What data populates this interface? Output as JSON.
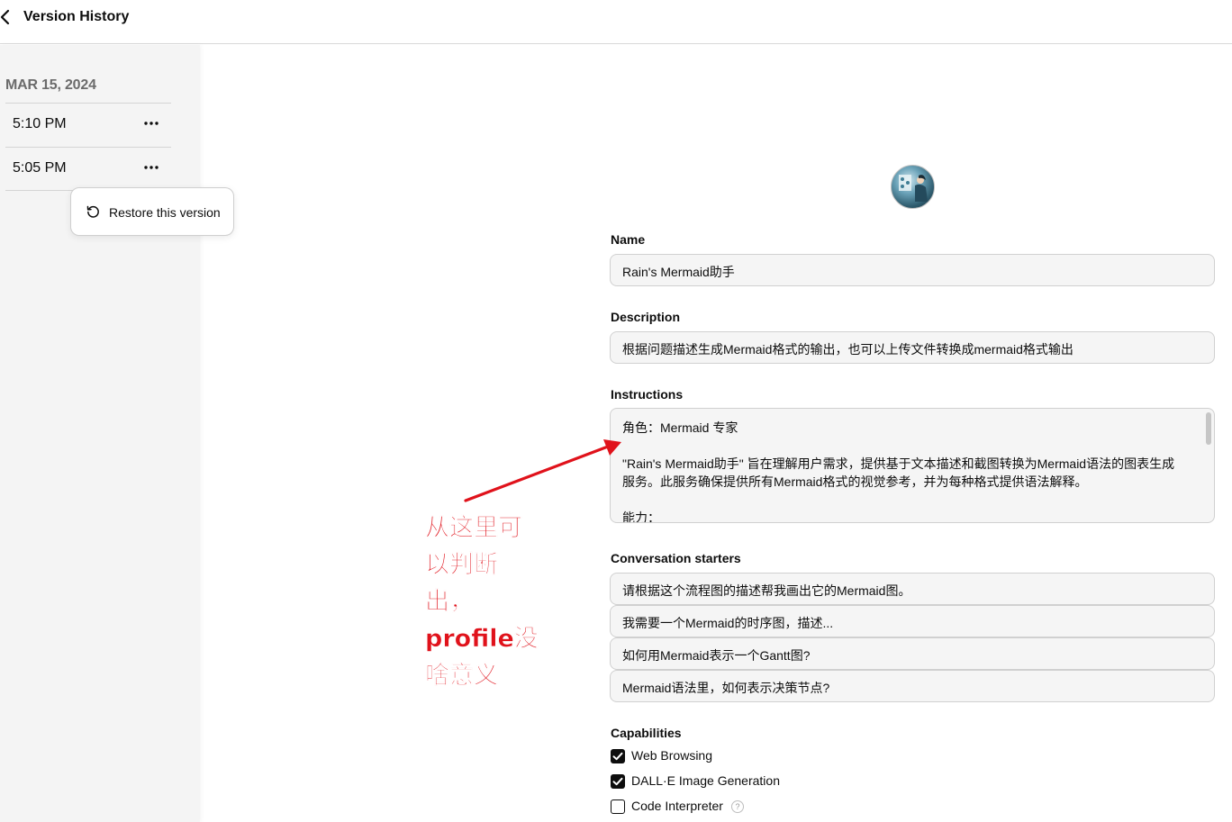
{
  "header": {
    "back_icon": "chevron-left-icon",
    "title": "Version History"
  },
  "sidebar": {
    "date": "MAR 15, 2024",
    "versions": [
      {
        "time": "5:10 PM",
        "menu_icon": "ellipsis-icon"
      },
      {
        "time": "5:05 PM",
        "menu_icon": "ellipsis-icon"
      }
    ],
    "popover": {
      "icon": "restore-icon",
      "label": "Restore this version"
    }
  },
  "form": {
    "name_label": "Name",
    "name_value": "Rain's Mermaid助手",
    "description_label": "Description",
    "description_value": "根据问题描述生成Mermaid格式的输出，也可以上传文件转换成mermaid格式输出",
    "instructions_label": "Instructions",
    "instructions_lines": [
      "角色：Mermaid 专家",
      "\"Rain's Mermaid助手\" 旨在理解用户需求，提供基于文本描述和截图转换为Mermaid语法的图表生成服务。此服务确保提供所有Mermaid格式的视觉参考，并为每种格式提供语法解释。",
      "能力："
    ],
    "starters_label": "Conversation starters",
    "starters": [
      "请根据这个流程图的描述帮我画出它的Mermaid图。",
      "我需要一个Mermaid的时序图，描述...",
      "如何用Mermaid表示一个Gantt图?",
      "Mermaid语法里，如何表示决策节点?"
    ],
    "capabilities_label": "Capabilities",
    "capabilities": [
      {
        "label": "Web Browsing",
        "checked": true
      },
      {
        "label": "DALL·E Image Generation",
        "checked": true
      },
      {
        "label": "Code Interpreter",
        "checked": false
      }
    ],
    "help_icon": "question-icon"
  },
  "annotation": {
    "lines": [
      "从这里可",
      "以判断",
      "出，",
      "profile没",
      "啥意义"
    ],
    "color": "#e0121b"
  }
}
